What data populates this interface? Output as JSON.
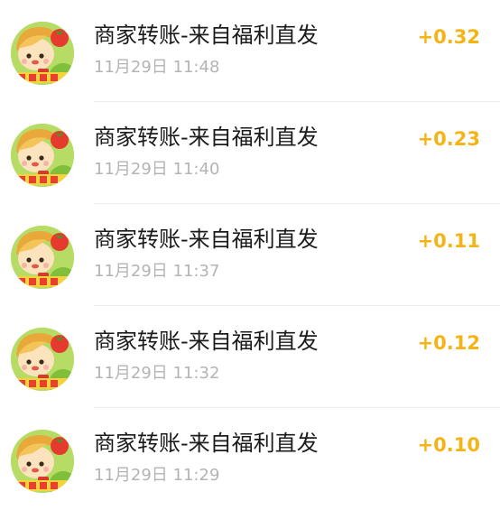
{
  "transactions": [
    {
      "title": "商家转账-来自福利直发",
      "time": "11月29日 11:48",
      "amount": "+0.32",
      "avatar_icon": "merchant-mascot-avatar"
    },
    {
      "title": "商家转账-来自福利直发",
      "time": "11月29日 11:40",
      "amount": "+0.23",
      "avatar_icon": "merchant-mascot-avatar"
    },
    {
      "title": "商家转账-来自福利直发",
      "time": "11月29日 11:37",
      "amount": "+0.11",
      "avatar_icon": "merchant-mascot-avatar"
    },
    {
      "title": "商家转账-来自福利直发",
      "time": "11月29日 11:32",
      "amount": "+0.12",
      "avatar_icon": "merchant-mascot-avatar"
    },
    {
      "title": "商家转账-来自福利直发",
      "time": "11月29日 11:29",
      "amount": "+0.10",
      "avatar_icon": "merchant-mascot-avatar"
    }
  ],
  "colors": {
    "amount": "#f5b415",
    "title": "#1b1b1b",
    "time": "#b4b4b4",
    "divider": "#ececec"
  }
}
